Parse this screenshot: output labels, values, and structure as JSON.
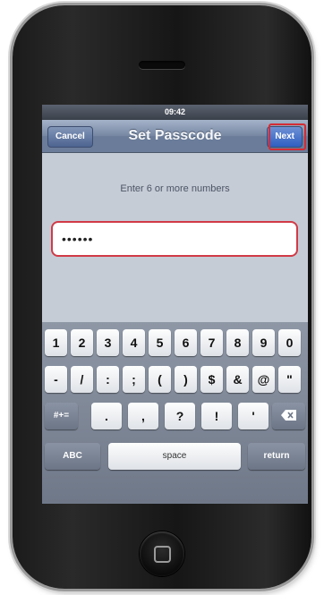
{
  "status_bar": {
    "signal": "",
    "time": "09:42",
    "battery": ""
  },
  "nav": {
    "cancel_label": "Cancel",
    "title": "Set Passcode",
    "next_label": "Next"
  },
  "prompt": "Enter 6 or more numbers",
  "passcode_field": {
    "value": "••••••"
  },
  "keyboard": {
    "row1": [
      "1",
      "2",
      "3",
      "4",
      "5",
      "6",
      "7",
      "8",
      "9",
      "0"
    ],
    "row2": [
      "-",
      "/",
      ":",
      ";",
      "(",
      ")",
      "$",
      "&",
      "@",
      "\""
    ],
    "row3": {
      "shift_label": "#+=",
      "keys": [
        ".",
        ",",
        "?",
        "!",
        "'"
      ],
      "delete_icon": "backspace-icon"
    },
    "row4": {
      "abc_label": "ABC",
      "space_label": "space",
      "return_label": "return"
    }
  },
  "highlight_color": "#d42c35"
}
